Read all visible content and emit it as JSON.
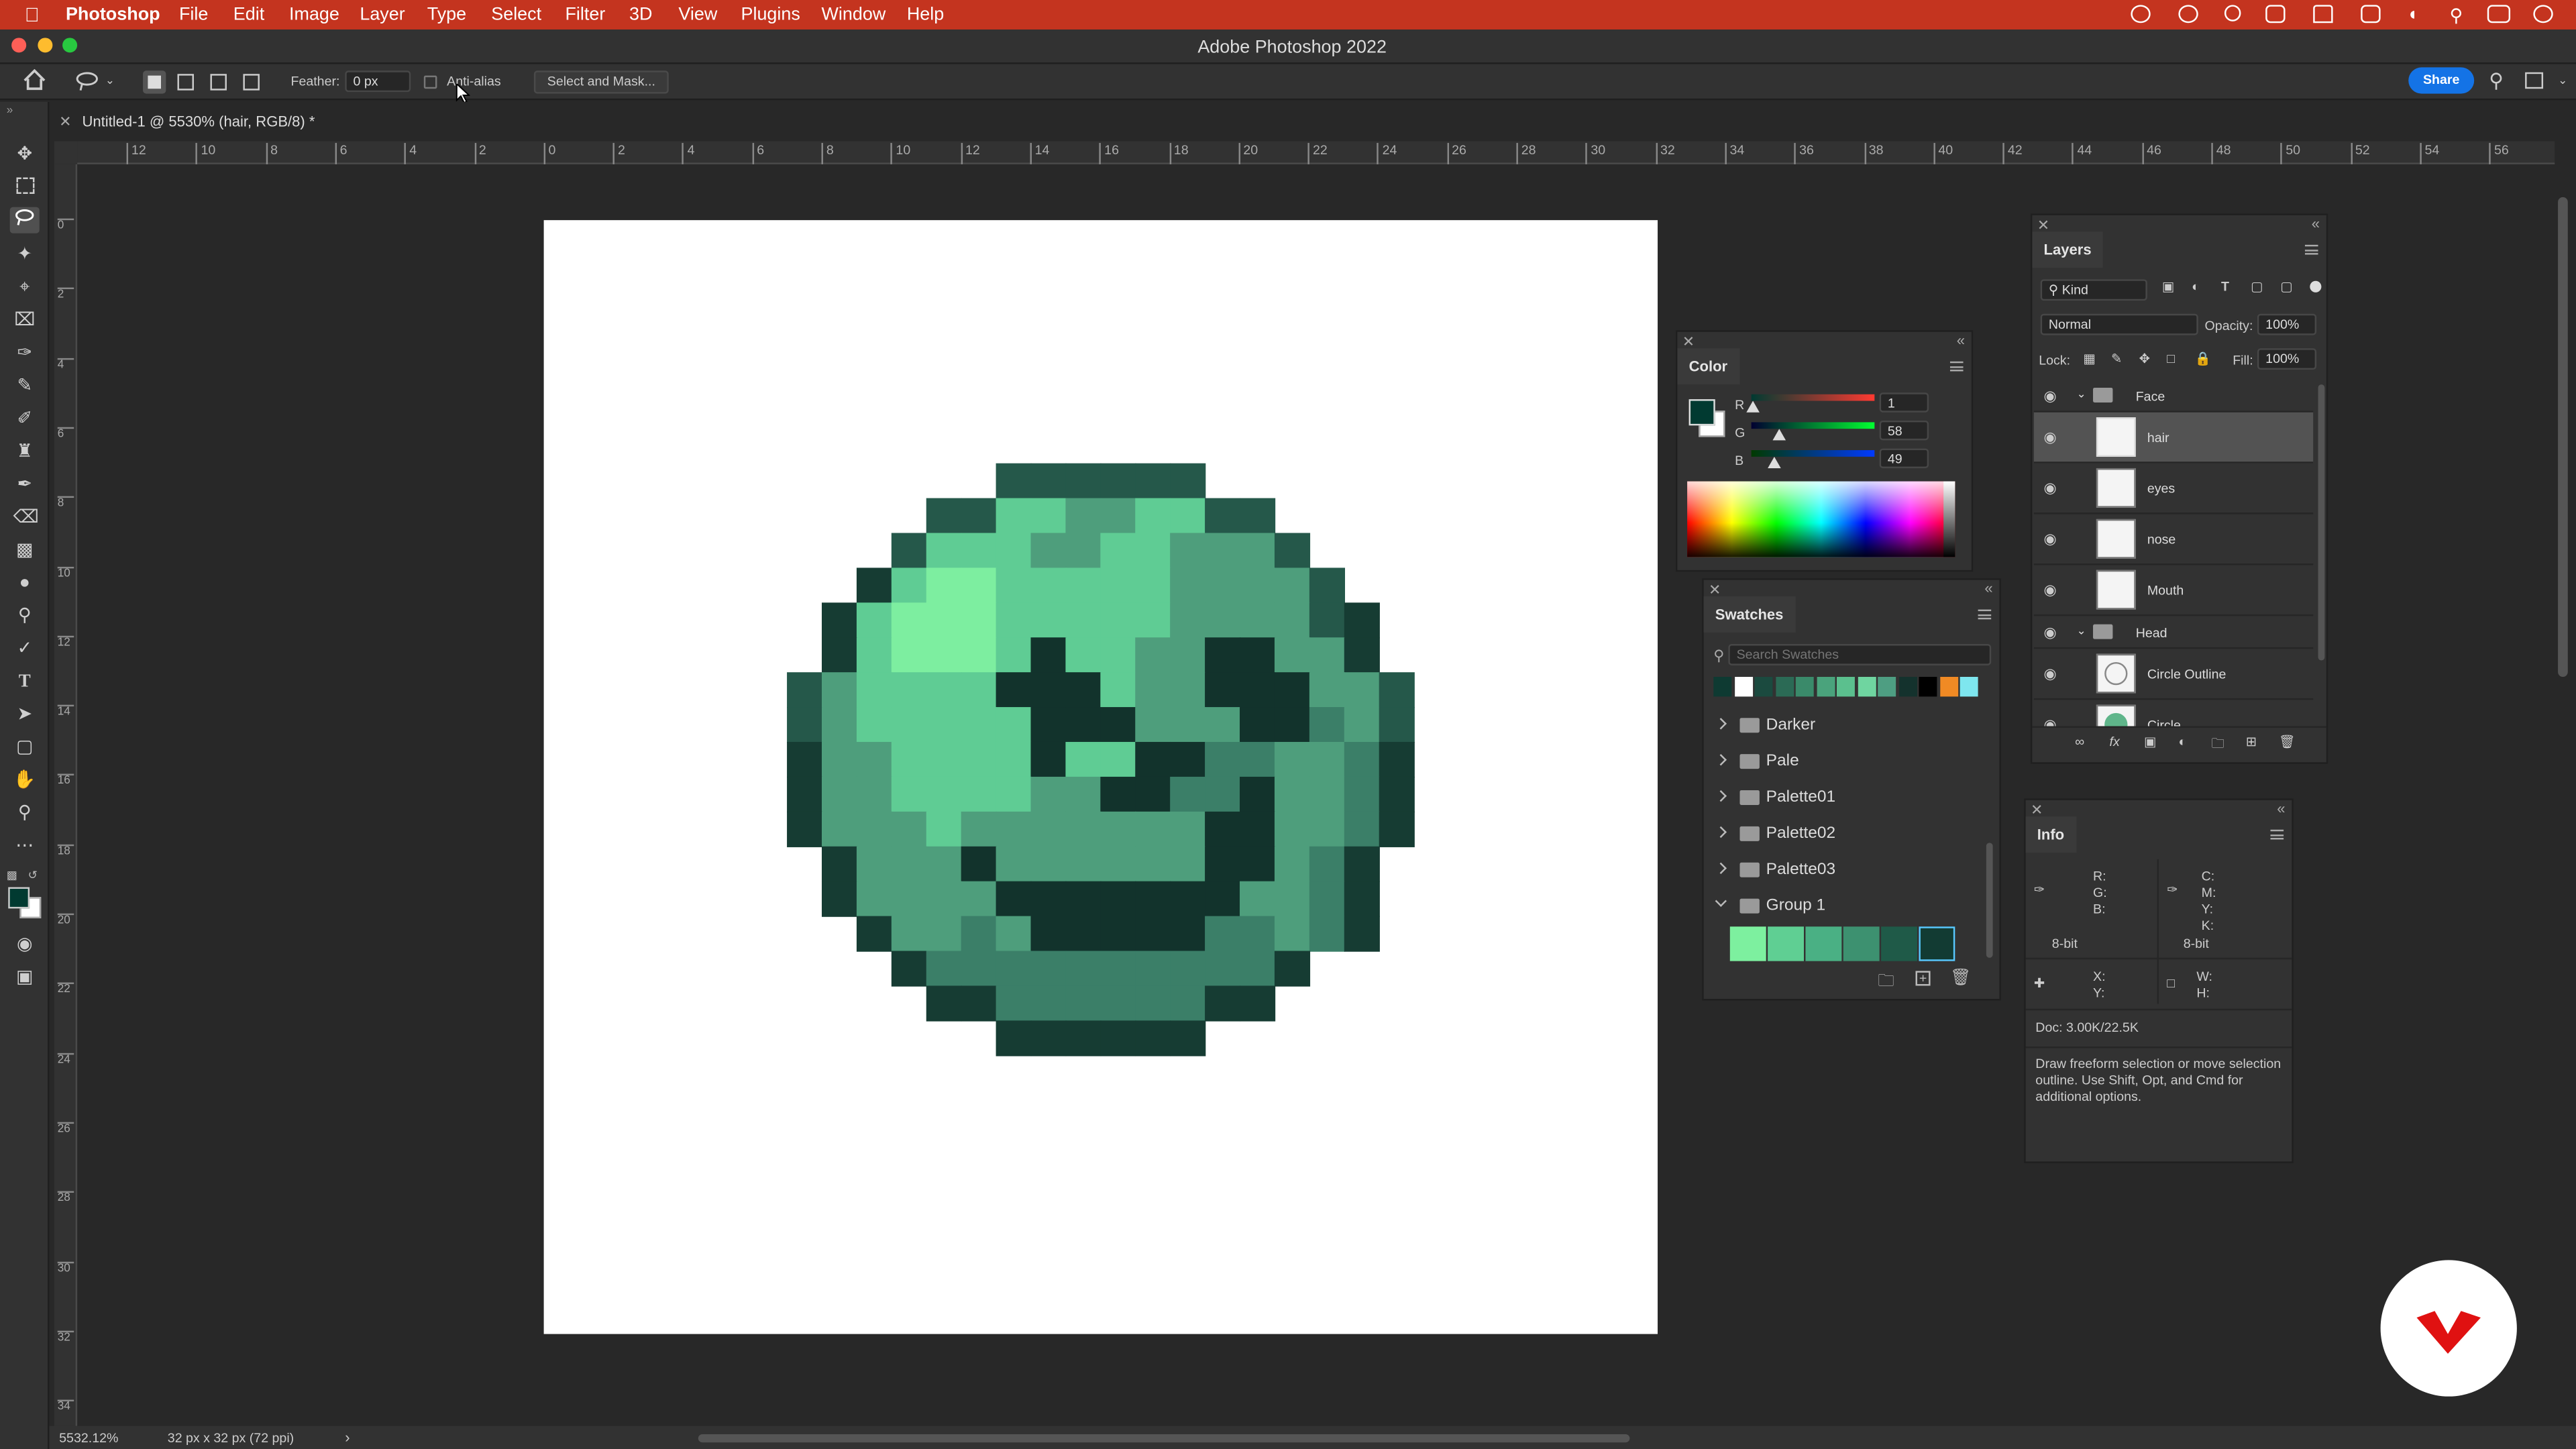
{
  "menubar": {
    "app_name": "Photoshop",
    "items": [
      "File",
      "Edit",
      "Image",
      "Layer",
      "Type",
      "Select",
      "Filter",
      "3D",
      "View",
      "Plugins",
      "Window",
      "Help"
    ]
  },
  "window": {
    "title": "Adobe Photoshop 2022"
  },
  "options": {
    "feather_label": "Feather:",
    "feather_value": "0 px",
    "antialias_label": "Anti-alias",
    "select_mask_label": "Select and Mask...",
    "share_label": "Share"
  },
  "document": {
    "tab_title": "Untitled-1 @ 5530% (hair, RGB/8) *"
  },
  "rulers": {
    "h_ticks": [
      "12",
      "10",
      "8",
      "6",
      "4",
      "2",
      "0",
      "2",
      "4",
      "6",
      "8",
      "10",
      "12",
      "14",
      "16",
      "18",
      "20",
      "22",
      "24",
      "26",
      "28",
      "30",
      "32",
      "34",
      "36",
      "38",
      "40",
      "42",
      "44",
      "46",
      "48",
      "50",
      "52",
      "54",
      "56"
    ],
    "v_ticks": [
      "0",
      "2",
      "4",
      "6",
      "8",
      "10",
      "12",
      "14",
      "16",
      "18",
      "20",
      "22",
      "24",
      "26",
      "28",
      "30",
      "32",
      "34"
    ]
  },
  "color_panel": {
    "title": "Color",
    "labels": [
      "R",
      "G",
      "B"
    ],
    "values": [
      "1",
      "58",
      "49"
    ],
    "foreground": "#013a31"
  },
  "swatches_panel": {
    "title": "Swatches",
    "search_placeholder": "Search Swatches",
    "top_colors": [
      "#0e3a32",
      "#ffffff",
      "#1b4a3f",
      "#2b6a55",
      "#3a8a6a",
      "#4aa37c",
      "#5bc08e",
      "#6fd5a0",
      "#4e9e82",
      "#14322d",
      "#000000",
      "#f08a24",
      "#7ee6ee"
    ],
    "groups": [
      "Darker",
      "Pale",
      "Palette01",
      "Palette02",
      "Palette03",
      "Group 1"
    ],
    "group1_colors": [
      "#7df09f",
      "#5fcf93",
      "#4ab084",
      "#3d9170",
      "#1f5a48",
      "#123b33"
    ]
  },
  "layers_panel": {
    "title": "Layers",
    "filter_kind": "Kind",
    "blend_mode": "Normal",
    "opacity_label": "Opacity:",
    "opacity_value": "100%",
    "lock_label": "Lock:",
    "fill_label": "Fill:",
    "fill_value": "100%",
    "group_face": "Face",
    "layers_face": [
      "hair",
      "eyes",
      "nose",
      "Mouth"
    ],
    "group_head": "Head",
    "layers_head": [
      "Circle Outline",
      "Circle"
    ]
  },
  "info_panel": {
    "title": "Info",
    "rgb_labels": [
      "R:",
      "G:",
      "B:"
    ],
    "cmyk_labels": [
      "C:",
      "M:",
      "Y:",
      "K:"
    ],
    "bit_left": "8-bit",
    "bit_right": "8-bit",
    "xy_labels": [
      "X:",
      "Y:"
    ],
    "wh_labels": [
      "W:",
      "H:"
    ],
    "doc_size": "Doc: 3.00K/22.5K",
    "hint": "Draw freeform selection or move selection outline.  Use Shift, Opt, and Cmd for additional options."
  },
  "status": {
    "zoom": "5532.12%",
    "doc_dims": "32 px x 32 px (72 ppi)"
  },
  "pixel_art": {
    "palette": {
      "a": "#25584a",
      "b": "#163c33",
      "c": "#2d6a58",
      "d": "#3b7f68",
      "e": "#4e9e7c",
      "f": "#5fcc94",
      "g": "#57b386",
      "h": "#7deea0",
      "k": "#12332c",
      "l": "#4aa37c"
    },
    "rows": [
      "......aaaaaa......",
      "....aaffeeffaa....",
      "...afffeeffeeea...",
      "..bfhhfffffeeeea..",
      ".bfhhhfffffeeeeab.",
      ".bfhhhfkffeekkeeb.",
      "aeffffkkkfeekkkeea",
      "aefffffkkkeeekkdea",
      "beeffffkffkkddeedb",
      "beeffffeekkddkeedb",
      "beeefeeeeeeekkeedb",
      ".beeekeeeeeekkedb.",
      ".beeeekkkkkkkeedb.",
      "..beedekkkkkddedb..",
      "...bddddddddddb...",
      "....bbddddddbb....",
      "......bbbbbb......"
    ]
  }
}
